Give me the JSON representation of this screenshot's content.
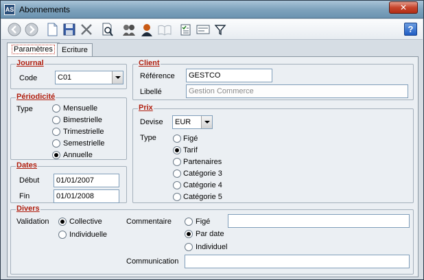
{
  "window": {
    "title": "Abonnements",
    "icon_text": "AS",
    "close_symbol": "✕",
    "help_symbol": "?"
  },
  "toolbar": {
    "buttons": [
      "back-icon",
      "forward-icon",
      "new-document-icon",
      "save-icon",
      "delete-icon",
      "preview-icon",
      "search-people-icon",
      "user-icon",
      "book-icon",
      "checklist-icon",
      "form-icon",
      "filter-icon"
    ]
  },
  "tabs": [
    {
      "label": "Paramètres",
      "active": true
    },
    {
      "label": "Ecriture",
      "active": false
    }
  ],
  "journal": {
    "legend": "Journal",
    "code_label": "Code",
    "code_value": "C01"
  },
  "periodicite": {
    "legend": "Périodicité",
    "type_label": "Type",
    "options": [
      {
        "label": "Mensuelle",
        "selected": false
      },
      {
        "label": "Bimestrielle",
        "selected": false
      },
      {
        "label": "Trimestrielle",
        "selected": false
      },
      {
        "label": "Semestrielle",
        "selected": false
      },
      {
        "label": "Annuelle",
        "selected": true
      }
    ]
  },
  "dates": {
    "legend": "Dates",
    "debut_label": "Début",
    "debut_value": "01/01/2007",
    "fin_label": "Fin",
    "fin_value": "01/01/2008"
  },
  "client": {
    "legend": "Client",
    "reference_label": "Référence",
    "reference_value": "GESTCO",
    "libelle_label": "Libellé",
    "libelle_value": "Gestion Commerce"
  },
  "prix": {
    "legend": "Prix",
    "devise_label": "Devise",
    "devise_value": "EUR",
    "type_label": "Type",
    "options": [
      {
        "label": "Figé",
        "selected": false
      },
      {
        "label": "Tarif",
        "selected": true
      },
      {
        "label": "Partenaires",
        "selected": false
      },
      {
        "label": "Catégorie 3",
        "selected": false
      },
      {
        "label": "Catégorie 4",
        "selected": false
      },
      {
        "label": "Catégorie 5",
        "selected": false
      }
    ]
  },
  "divers": {
    "legend": "Divers",
    "validation_label": "Validation",
    "validation_options": [
      {
        "label": "Collective",
        "selected": true
      },
      {
        "label": "Individuelle",
        "selected": false
      }
    ],
    "commentaire_label": "Commentaire",
    "commentaire_options": [
      {
        "label": "Figé",
        "selected": false
      },
      {
        "label": "Par date",
        "selected": true
      },
      {
        "label": "Individuel",
        "selected": false
      }
    ],
    "commentaire_value": "",
    "communication_label": "Communication",
    "communication_value": ""
  }
}
